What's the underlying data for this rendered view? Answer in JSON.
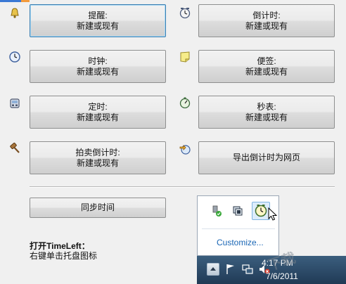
{
  "buttons": {
    "reminder": {
      "line1": "提醒:",
      "line2": "新建或现有"
    },
    "countdown": {
      "line1": "倒计时:",
      "line2": "新建或现有"
    },
    "clock": {
      "line1": "时钟:",
      "line2": "新建或现有"
    },
    "note": {
      "line1": "便签:",
      "line2": "新建或现有"
    },
    "timer": {
      "line1": "定时:",
      "line2": "新建或现有"
    },
    "stopwatch": {
      "line1": "秒表:",
      "line2": "新建或现有"
    },
    "auction": {
      "line1": "拍卖倒计时:",
      "line2": "新建或现有"
    },
    "export": {
      "label": "导出倒计时为网页"
    },
    "sync": {
      "label": "同步时间"
    }
  },
  "hint": {
    "title": "打开TimeLeft：",
    "text": "右键单击托盘图标"
  },
  "tray": {
    "customize": "Customize...",
    "time": "4:17 PM",
    "date": "7/6/2011"
  },
  "icons": {
    "reminder": "bell-icon",
    "countdown": "countdown-clock-icon",
    "clock": "clock-icon",
    "note": "sticky-note-icon",
    "timer": "timer-icon",
    "stopwatch": "stopwatch-icon",
    "auction": "gavel-icon",
    "export": "web-export-icon"
  },
  "watermark": "下载",
  "colors": {
    "accent": "#3a78d4",
    "taskbar": "#2a4866",
    "link": "#1a66b5"
  }
}
